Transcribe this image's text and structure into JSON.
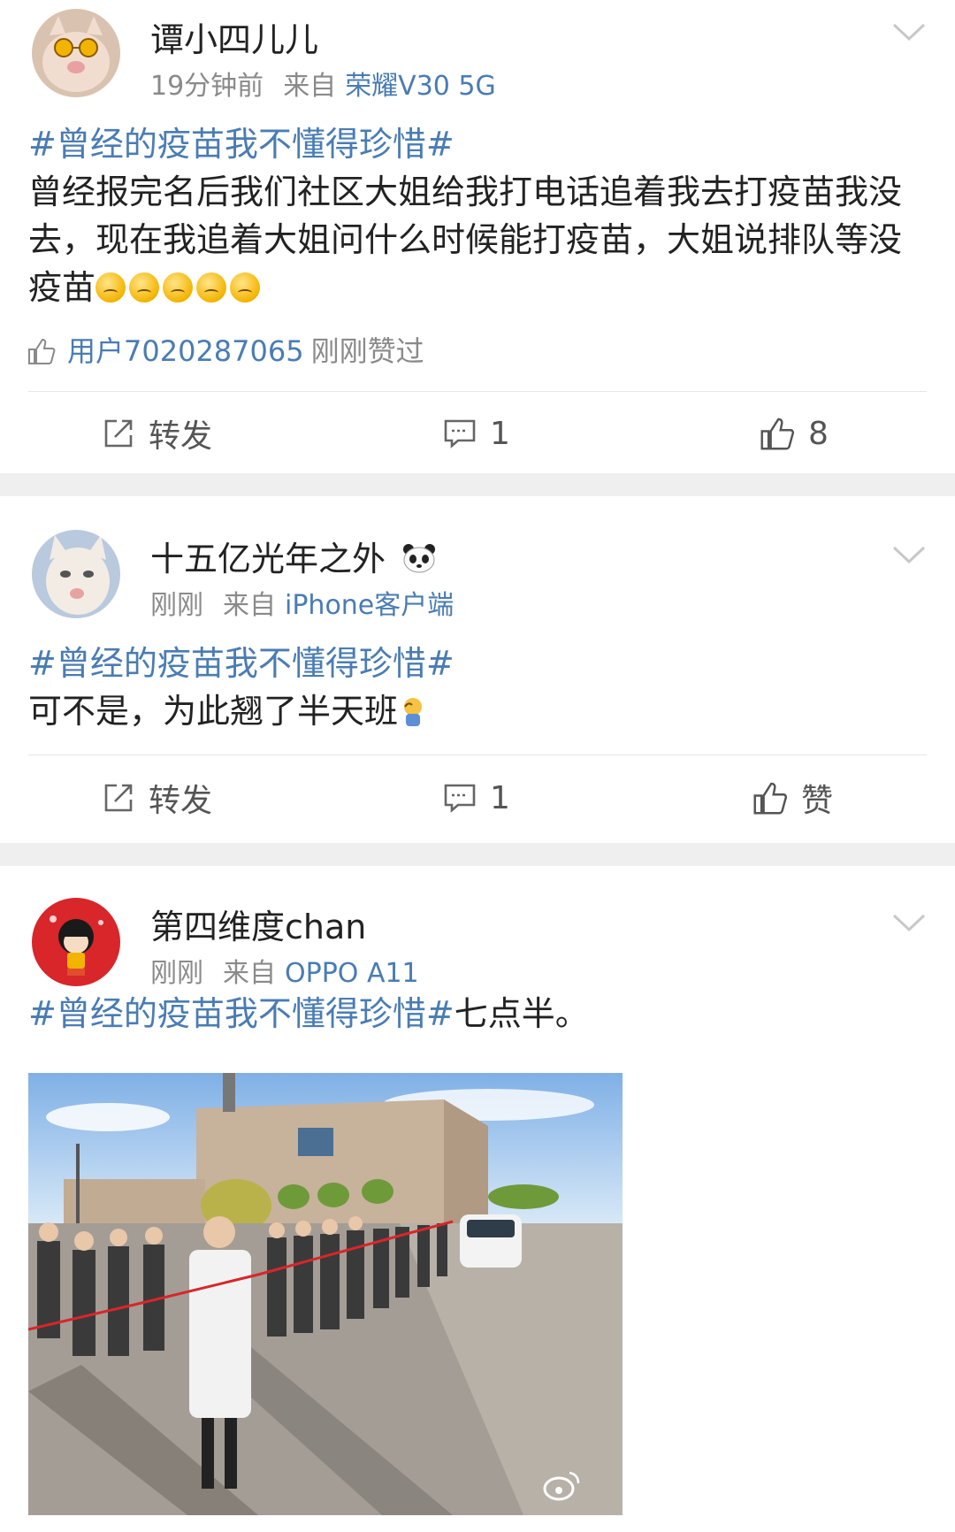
{
  "posts": [
    {
      "username": "谭小四儿儿",
      "time": "19分钟前",
      "from_label": "来自",
      "source": "荣耀V30 5G",
      "hashtag": "#曾经的疫苗我不懂得珍惜#",
      "body": "曾经报完名后我们社区大姐给我打电话追着我去打疫苗我没去，现在我追着大姐问什么时候能打疫苗，大姐说排队等没疫苗",
      "emoji_count": 5,
      "liked_by": "用户7020287065",
      "liked_suffix": "刚刚赞过",
      "repost_label": "转发",
      "comment_count": "1",
      "like_count": "8"
    },
    {
      "username": "十五亿光年之外",
      "time": "刚刚",
      "from_label": "来自",
      "source": "iPhone客户端",
      "hashtag": "#曾经的疫苗我不懂得珍惜#",
      "body": "可不是，为此翘了半天班",
      "repost_label": "转发",
      "comment_count": "1",
      "like_label": "赞"
    },
    {
      "username": "第四维度chan",
      "time": "刚刚",
      "from_label": "来自",
      "source": "OPPO A11",
      "hashtag": "#曾经的疫苗我不懂得珍惜#",
      "body": "七点半。"
    }
  ],
  "colors": {
    "link": "#4a7cb3",
    "meta": "#8a8a8a",
    "separator": "#efefef"
  },
  "icons": [
    "repost-icon",
    "comment-icon",
    "thumbs-up-icon",
    "chevron-down-icon",
    "panda-icon",
    "weibo-watermark-icon"
  ]
}
